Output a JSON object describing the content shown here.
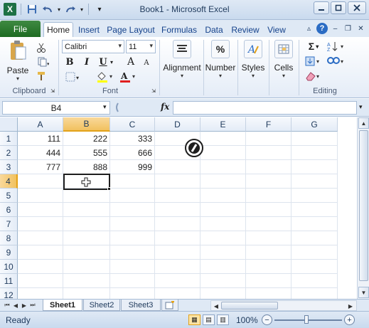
{
  "window": {
    "title": "Book1 - Microsoft Excel"
  },
  "colors": {
    "excel_green": "#1e7145",
    "accent_blue": "#15428b",
    "selection_orange": "#f1c15f"
  },
  "tabs": {
    "file": "File",
    "items": [
      "Home",
      "Insert",
      "Page Layout",
      "Formulas",
      "Data",
      "Review",
      "View"
    ],
    "active": "Home"
  },
  "ribbon": {
    "clipboard": {
      "paste_label": "Paste",
      "group_label": "Clipboard"
    },
    "font": {
      "font_name": "Calibri",
      "font_size": "11",
      "bold": "B",
      "italic": "I",
      "underline": "U",
      "grow": "A",
      "shrink": "A",
      "font_color": "A",
      "group_label": "Font"
    },
    "alignment": {
      "label": "Alignment"
    },
    "number": {
      "label": "Number",
      "icon_text": "%"
    },
    "styles": {
      "label": "Styles"
    },
    "cells": {
      "label": "Cells"
    },
    "editing": {
      "group_label": "Editing",
      "sum_symbol": "Σ"
    }
  },
  "formula_bar": {
    "name_box": "B4",
    "fx": "fx",
    "formula": ""
  },
  "sheet": {
    "columns": [
      "A",
      "B",
      "C",
      "D",
      "E",
      "F",
      "G"
    ],
    "rows": [
      "1",
      "2",
      "3",
      "4",
      "5",
      "6",
      "7",
      "8",
      "9",
      "10",
      "11",
      "12"
    ],
    "selected_col": "B",
    "selected_row": "4",
    "cells": [
      [
        "111",
        "222",
        "333"
      ],
      [
        "444",
        "555",
        "666"
      ],
      [
        "777",
        "888",
        "999"
      ]
    ]
  },
  "sheet_tabs": {
    "items": [
      "Sheet1",
      "Sheet2",
      "Sheet3"
    ],
    "active": "Sheet1"
  },
  "status_bar": {
    "ready": "Ready",
    "zoom": "100%",
    "zoom_in": "+",
    "zoom_out": "−"
  }
}
